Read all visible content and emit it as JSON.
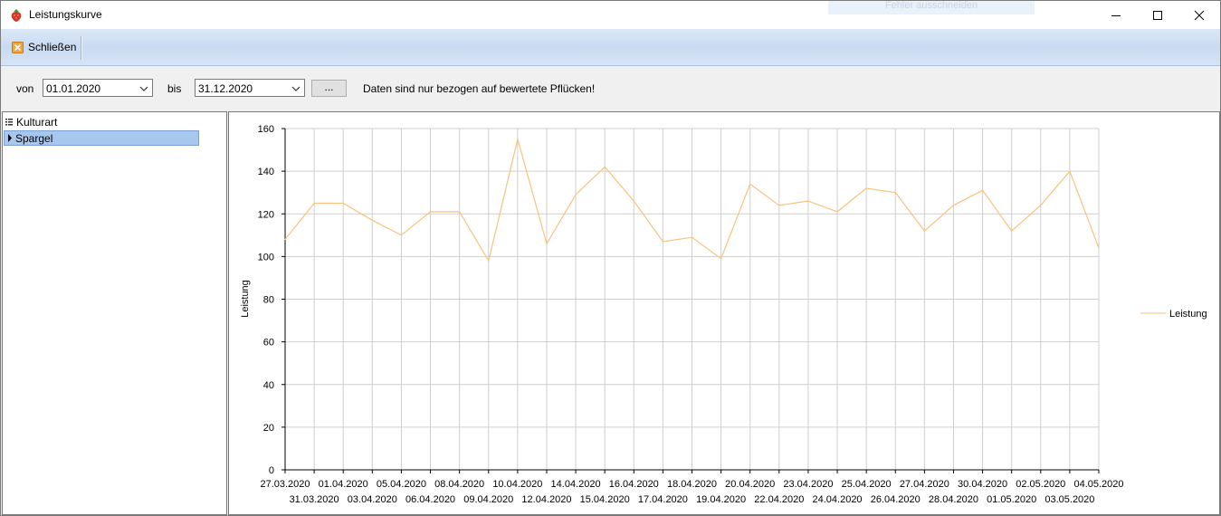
{
  "window": {
    "title": "Leistungskurve",
    "ghost_text": "Fehler ausschneiden"
  },
  "toolbar": {
    "close_label": "Schließen"
  },
  "filter": {
    "from_label": "von",
    "from_value": "01.01.2020",
    "to_label": "bis",
    "to_value": "31.12.2020",
    "more_label": "...",
    "note": "Daten sind nur bezogen auf bewertete Pflücken!"
  },
  "tree": {
    "header": "Kulturart",
    "items": [
      "Spargel"
    ]
  },
  "colors": {
    "series": "#f7c27e",
    "selection": "#a8c7ee",
    "grid": "#cfcfcf"
  },
  "chart_data": {
    "type": "line",
    "ylabel": "Leistung",
    "ylim": [
      0,
      160
    ],
    "yticks": [
      0,
      20,
      40,
      60,
      80,
      100,
      120,
      140,
      160
    ],
    "grid": true,
    "legend_position": "right",
    "x": [
      "27.03.2020",
      "31.03.2020",
      "01.04.2020",
      "03.04.2020",
      "05.04.2020",
      "06.04.2020",
      "08.04.2020",
      "09.04.2020",
      "10.04.2020",
      "12.04.2020",
      "14.04.2020",
      "15.04.2020",
      "16.04.2020",
      "17.04.2020",
      "18.04.2020",
      "19.04.2020",
      "20.04.2020",
      "22.04.2020",
      "23.04.2020",
      "24.04.2020",
      "25.04.2020",
      "26.04.2020",
      "27.04.2020",
      "28.04.2020",
      "30.04.2020",
      "01.05.2020",
      "02.05.2020",
      "03.05.2020",
      "04.05.2020"
    ],
    "series": [
      {
        "name": "Leistung",
        "values": [
          108,
          125,
          125,
          117,
          110,
          121,
          121,
          98,
          155,
          106,
          129,
          142,
          126,
          107,
          109,
          99,
          134,
          124,
          126,
          121,
          132,
          130,
          112,
          124,
          131,
          112,
          124,
          140,
          104
        ]
      }
    ]
  }
}
